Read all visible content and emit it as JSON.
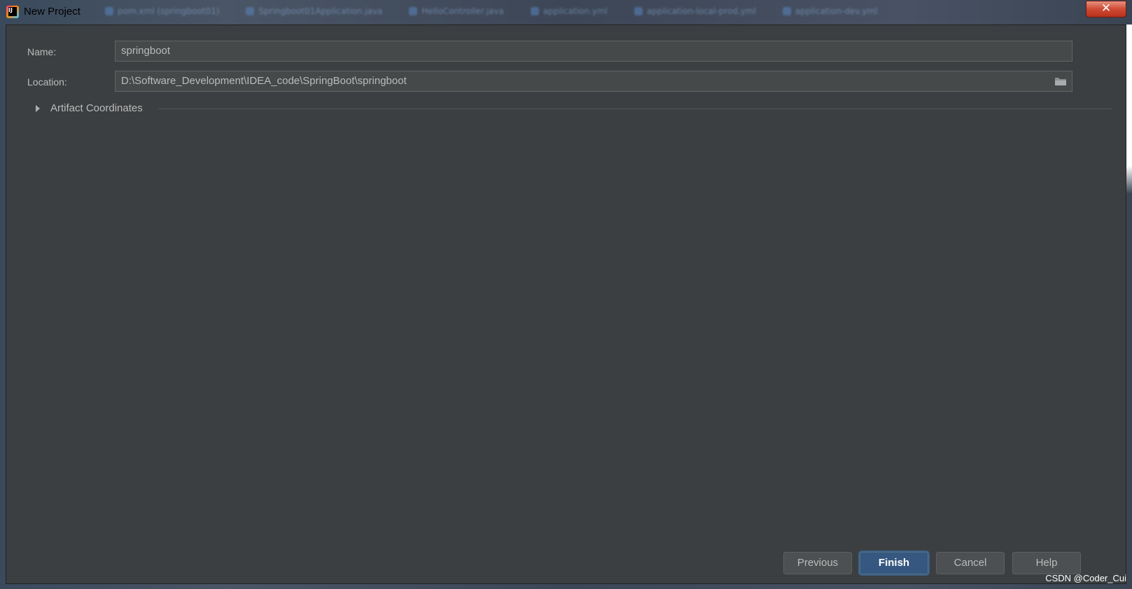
{
  "window": {
    "title": "New Project",
    "close_glyph": "✕"
  },
  "background_tabs": [
    "pom.xml (springboot01)",
    "Springboot01Application.java",
    "HelloController.java",
    "application.yml",
    "application-local-prod.yml",
    "application-dev.yml"
  ],
  "form": {
    "name_label": "Name:",
    "name_value": "springboot",
    "location_label": "Location:",
    "location_value": "D:\\Software_Development\\IDEA_code\\SpringBoot\\springboot",
    "artifact_label": "Artifact Coordinates"
  },
  "buttons": {
    "previous": "Previous",
    "finish": "Finish",
    "cancel": "Cancel",
    "help": "Help"
  },
  "watermark": "CSDN @Coder_Cui",
  "colors": {
    "dialog_bg": "#3c3f41",
    "field_bg": "#45494a",
    "primary_button": "#365880",
    "text": "#bbbbbb"
  },
  "icons": {
    "app": "intellij-icon",
    "folder": "folder-icon",
    "expand": "triangle-right-icon",
    "close": "close-icon"
  }
}
